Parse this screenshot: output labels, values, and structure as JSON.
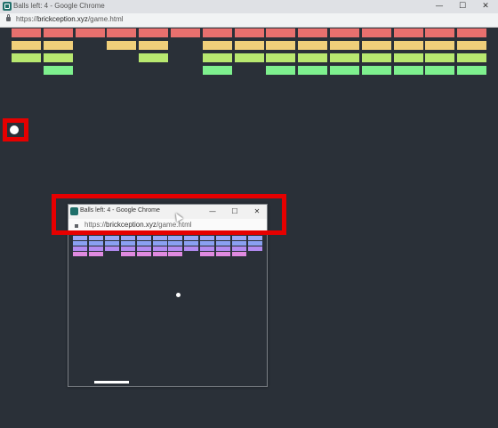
{
  "window": {
    "title": "Balls left: 4 - Google Chrome",
    "url_scheme": "https://",
    "url_host": "brickception.xyz",
    "url_path": "/game.html"
  },
  "controls": {
    "minimize_icon": "minimize-icon",
    "maximize_icon": "maximize-icon",
    "close_icon": "close-icon",
    "minimize_glyph": "—",
    "maximize_glyph": "☐",
    "close_glyph": "✕"
  },
  "inner_window": {
    "title": "Balls left: 4 - Google Chrome",
    "url_scheme": "https://",
    "url_host": "brickception.xyz",
    "url_path": "/game.html"
  },
  "colors": {
    "background": "#2a3038",
    "row1": "#e8706e",
    "row2": "#f0cf7a",
    "row3": "#b8e870",
    "row4": "#7ef08e",
    "inner_row1": "#9aa6f4",
    "inner_row2": "#8aa0f2",
    "inner_row3": "#b28af0",
    "inner_row4": "#e08ae0",
    "marker": "#e60000"
  },
  "outer_bricks": [
    [
      1,
      1,
      1,
      1,
      1,
      1,
      1,
      1,
      1,
      1,
      1,
      1,
      1,
      1,
      1
    ],
    [
      1,
      1,
      0,
      1,
      1,
      0,
      1,
      1,
      1,
      1,
      1,
      1,
      1,
      1,
      1
    ],
    [
      1,
      1,
      0,
      0,
      1,
      0,
      1,
      1,
      1,
      1,
      1,
      1,
      1,
      1,
      1
    ],
    [
      0,
      1,
      0,
      0,
      0,
      0,
      1,
      0,
      1,
      1,
      1,
      1,
      1,
      1,
      1
    ]
  ],
  "inner_bricks": [
    [
      1,
      1,
      1,
      1,
      1,
      1,
      1,
      1,
      1,
      1,
      1,
      1
    ],
    [
      1,
      1,
      1,
      1,
      1,
      1,
      1,
      1,
      1,
      1,
      1,
      1
    ],
    [
      1,
      1,
      1,
      1,
      1,
      1,
      1,
      1,
      1,
      1,
      1,
      1
    ],
    [
      1,
      1,
      0,
      1,
      1,
      1,
      1,
      0,
      1,
      1,
      1,
      0
    ]
  ]
}
